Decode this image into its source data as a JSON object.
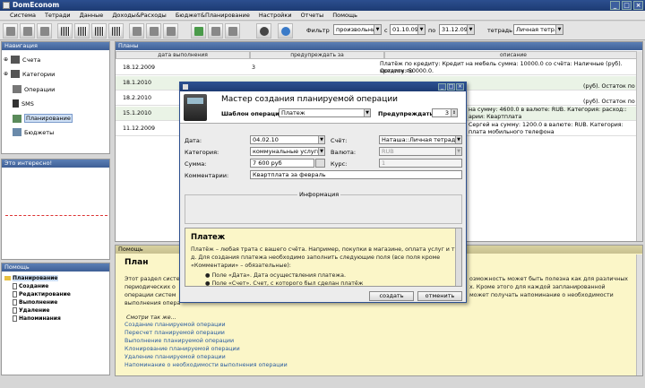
{
  "window": {
    "title": "DomEconom"
  },
  "menu": [
    "Система",
    "Тетради",
    "Данные",
    "Доходы&Расходы",
    "Бюджет&Планирование",
    "Настройки",
    "Отчеты",
    "Помощь"
  ],
  "filter": {
    "label": "Фильтр",
    "mode": "произвольный",
    "from_label": "с",
    "from_date": "01.10.09",
    "to_label": "по",
    "to_date": "31.12.09",
    "notebook_label": "тетрадь",
    "notebook": "Личная тетр..."
  },
  "nav": {
    "header": "Навигация",
    "items": [
      "Счета",
      "Категории",
      "Операции",
      "SMS",
      "Планирование",
      "Бюджеты"
    ]
  },
  "interesting": {
    "header": "Это интересно!"
  },
  "help_nav": {
    "header": "Помощь",
    "items": [
      "Планирование",
      "Создание",
      "Редактирование",
      "Выполнение",
      "Удаление",
      "Напоминания"
    ]
  },
  "plans": {
    "header": "Планы",
    "columns": [
      "дата выполнения",
      "предупреждать за",
      "описание"
    ],
    "rows": [
      {
        "date": "18.12.2009",
        "warn": "3",
        "desc1": "Платёж по кредиту: Кредит на мебель сумма: 10000.0 со счёта: Наличные (руб). Остаток по",
        "desc2": "кредиту:-50000.0."
      },
      {
        "date": "18.1.2010",
        "warn": "",
        "desc1": "",
        "desc2": "(руб). Остаток по"
      },
      {
        "date": "18.2.2010",
        "warn": "",
        "desc1": "",
        "desc2": "(руб). Остаток по"
      },
      {
        "date": "15.1.2010",
        "warn": "",
        "desc1": "на сумму: 4600.0 в валюте: RUB.  Категория: расход::",
        "desc2": "арии: Квартплата"
      },
      {
        "date": "11.12.2009",
        "warn": "",
        "desc1": "Сергей на сумму: 1200.0 в валюте: RUB.  Категория:",
        "desc2": "плата мобильного телефона"
      }
    ]
  },
  "help": {
    "header": "Помощь",
    "title": "План",
    "p1a": "Этот раздел систе",
    "p1b": "периодических о",
    "p1c": "операции систем",
    "p1d": "выполнения опера",
    "p1r1": "озможность может быть полезна как для различных",
    "p1r2": "х. Кроме этого для каждой запланированной",
    "p1r3": "может получать напоминание о необходимости",
    "see_also": "Смотри так же...",
    "links": [
      "Создание планируемой операции",
      "Пересчет планируемой операции",
      "Выполнение планируемой операции",
      "Клонирование планируемой операции",
      "Удаление планируемой операции",
      "Напоминание о необходимости выполнения операции"
    ]
  },
  "modal": {
    "title": "Мастер создания планируемой операции",
    "template_label": "Шаблон операции:",
    "template": "Платеж",
    "warn_label": "Предупреждать за:",
    "warn_value": "3",
    "date_label": "Дата:",
    "date": "04.02.10",
    "account_label": "Счёт:",
    "account": "Наташа::Личная тетрадь",
    "category_label": "Категория:",
    "category": "коммунальные услуги:...",
    "currency_label": "Валюта:",
    "currency": "RUB",
    "sum_label": "Сумма:",
    "sum": "7 600 руб",
    "rate_label": "Курс:",
    "rate": "1",
    "comment_label": "Комментарии:",
    "comment": "Квартплата за февраль",
    "info_label": "Информация",
    "help_title": "Платеж",
    "help_text1": "Платёж – любая трата с вашего счёта. Например, покупки в магазине, оплата услуг и т.",
    "help_text2": "д. Для создания платежа необходимо заполнить следующие поля (все поля кроме",
    "help_text3": "«Комментарии» – обязательные):",
    "bullet1": "Поле «Дата». Дата осуществления платежа.",
    "bullet2": "Поле «Счет». Счет, с которого был сделан платёж",
    "create_btn": "создать",
    "cancel_btn": "отменить"
  }
}
